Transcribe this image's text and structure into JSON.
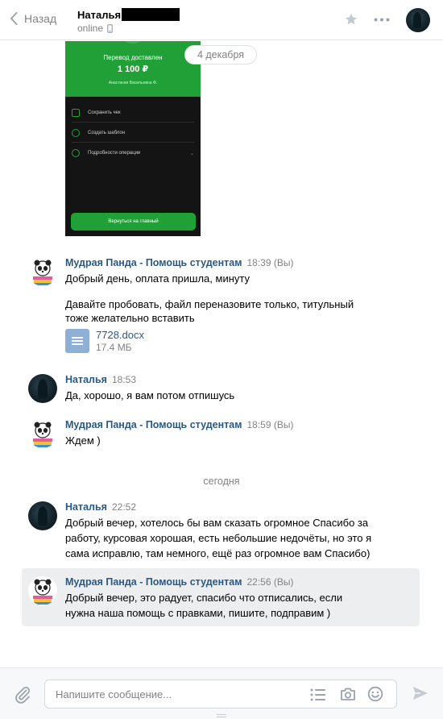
{
  "header": {
    "back_label": "Назад",
    "peer_name": "Наталья",
    "peer_status": "online"
  },
  "receipt": {
    "status": "Перевод доставлен",
    "amount": "1 100 ₽",
    "recipient": "Анастасия Васильевна Ф.",
    "actions": [
      "Сохранить чек",
      "Создать шаблон",
      "Подробности операции"
    ],
    "button": "Вернуться на главный"
  },
  "date_pill": "4 декабря",
  "messages": [
    {
      "author": "Мудрая Панда - Помощь студентам",
      "time": "18:39 (Вы)",
      "lines": [
        "Добрый день, оплата пришла, минуту"
      ],
      "lines2": [
        "Давайте пробовать, файл переназовите только, титульный",
        "тоже желательно вставить"
      ],
      "file": {
        "name": "7728.docx",
        "size": "17.4 МБ"
      }
    },
    {
      "author": "Наталья",
      "time": "18:53",
      "lines": [
        "Да, хорошо, я вам потом отпишусь"
      ]
    },
    {
      "author": "Мудрая Панда - Помощь студентам",
      "time": "18:59 (Вы)",
      "lines": [
        "Ждем )"
      ]
    },
    {
      "author": "Наталья",
      "time": "22:52",
      "lines": [
        "Добрый вечер, хотелось бы вам сказать огромное Спасибо за",
        "работу, курсовая хорошая, есть небольшие недочёты, но это я",
        "сама исправлю, там немного, ещё раз огромное вам Спасибо)"
      ]
    },
    {
      "author": "Мудрая Панда - Помощь студентам",
      "time": "22:56 (Вы)",
      "lines": [
        "Добрый вечер, это радует, спасибо что отписались, если",
        "нужна наша помощь с правками, пишите, подправим )"
      ]
    }
  ],
  "separator_today": "сегодня",
  "composer": {
    "placeholder": "Напишите сообщение..."
  },
  "colors": {
    "link": "#2a5885",
    "muted": "#828282",
    "selected_bg": "#edeef0",
    "receipt_green": "#21a038"
  }
}
